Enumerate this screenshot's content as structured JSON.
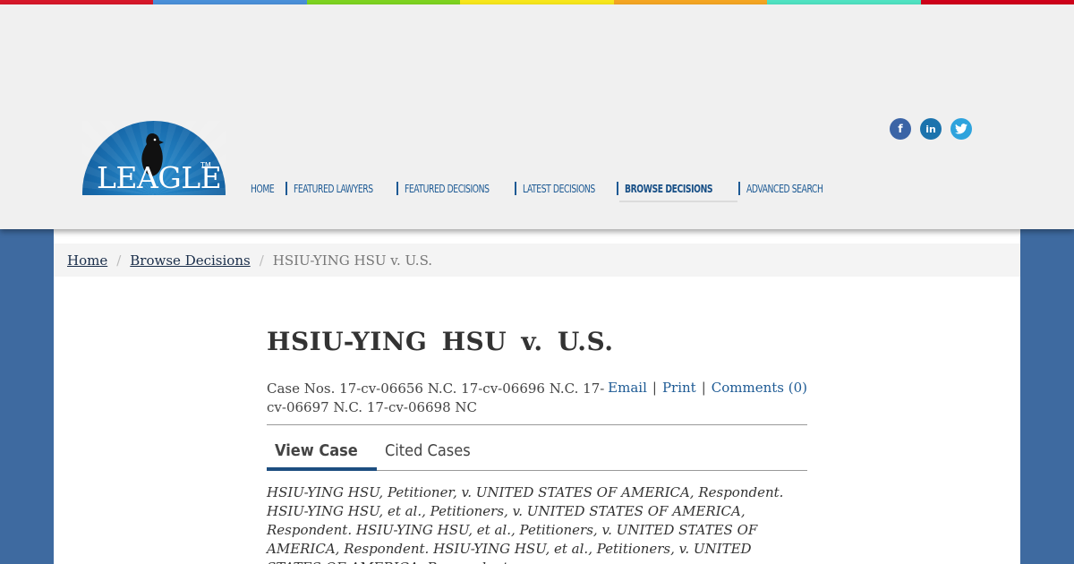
{
  "colors": {
    "stripe": [
      "#d7182a",
      "#4a90d9",
      "#7ed321",
      "#f8e71c",
      "#f5a623",
      "#50e3c2",
      "#d0021b"
    ],
    "brand_blue": "#1d5a94",
    "page_background": "#3e6aa0"
  },
  "logo": {
    "text": "LEAGLE",
    "trademark": "TM"
  },
  "nav": {
    "items": [
      {
        "label": "Home"
      },
      {
        "label": "Featured Lawyers"
      },
      {
        "label": "Featured Decisions"
      },
      {
        "label": "Latest Decisions"
      },
      {
        "label": "Browse Decisions"
      },
      {
        "label": "Advanced Search"
      }
    ]
  },
  "social": {
    "facebook": {
      "icon": "facebook-icon",
      "glyph": "f"
    },
    "linkedin": {
      "icon": "linkedin-icon",
      "glyph": "in"
    },
    "twitter": {
      "icon": "twitter-icon"
    }
  },
  "breadcrumb": {
    "home": "Home",
    "browse": "Browse Decisions",
    "current": "HSIU-YING HSU v. U.S."
  },
  "case": {
    "title": "HSIU-YING HSU v. U.S.",
    "case_numbers": "Case Nos. 17-cv-06656 N.C. 17-cv-06696 N.C. 17-cv-06697 N.C. 17-cv-06698 NC",
    "actions": {
      "email": "Email",
      "print": "Print",
      "comments": "Comments (0)"
    },
    "tabs": {
      "view": "View Case",
      "cited": "Cited Cases"
    },
    "parties": "HSIU-YING HSU, Petitioner, v. UNITED STATES OF AMERICA, Respondent. HSIU-YING HSU, et al., Petitioners, v. UNITED STATES OF AMERICA, Respondent. HSIU-YING HSU, et al., Petitioners, v. UNITED STATES OF AMERICA, Respondent. HSIU-YING HSU, et al., Petitioners, v. UNITED STATES OF AMERICA, Respondent."
  }
}
